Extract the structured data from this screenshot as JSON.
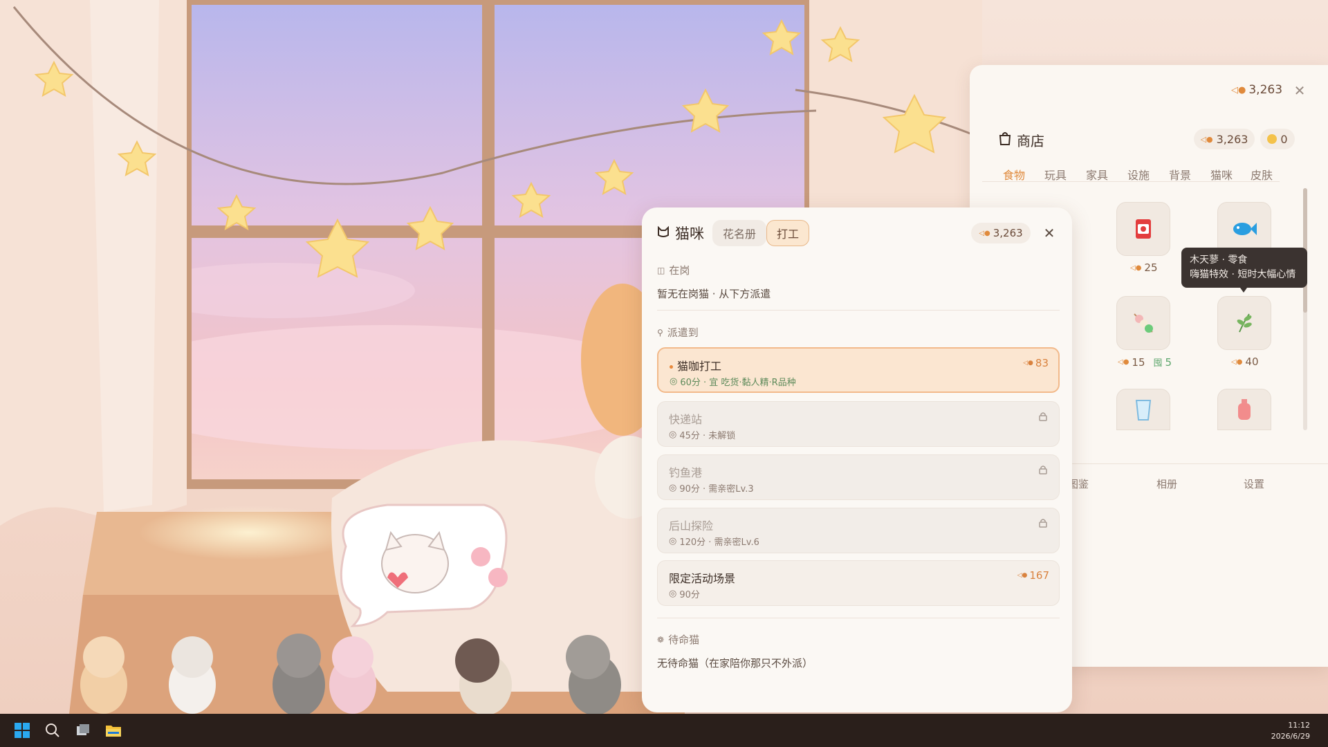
{
  "shop": {
    "top_coins": "3,263",
    "title": "商店",
    "coins_pill": "3,263",
    "gems_pill": "0",
    "tabs": [
      "食物",
      "玩具",
      "家具",
      "设施",
      "背景",
      "猫咪",
      "皮肤"
    ],
    "active_tab": "食物",
    "items": [
      {
        "icon": "canned-food-icon",
        "price": "25",
        "extra": ""
      },
      {
        "icon": "fish-icon",
        "price": "",
        "extra": ""
      },
      {
        "icon": "dango-icon",
        "price": "15",
        "extra": "5"
      },
      {
        "icon": "catnip-icon",
        "price": "40",
        "extra": ""
      },
      {
        "icon": "milk-icon",
        "price": "",
        "extra": ""
      },
      {
        "icon": "bottle-icon",
        "price": "",
        "extra": ""
      }
    ],
    "tooltip": {
      "line1": "木天蓼 · 零食",
      "line2": "嗨猫特效 · 短时大幅心情"
    },
    "bottom_nav": [
      "图鉴",
      "相册",
      "设置"
    ]
  },
  "cat_panel": {
    "title": "猫咪",
    "tab_roster": "花名册",
    "tab_work": "打工",
    "coins": "3,263",
    "on_duty_label": "在岗",
    "on_duty_text": "暂无在岗猫 · 从下方派遣",
    "dispatch_label": "派遣到",
    "jobs": [
      {
        "name": "猫咖打工",
        "meta": "60分 · 宜 吃货·黏人精·R品种",
        "reward": "83",
        "state": "selected"
      },
      {
        "name": "快递站",
        "meta": "45分 · 未解锁",
        "reward": "",
        "state": "locked"
      },
      {
        "name": "钓鱼港",
        "meta": "90分 · 需亲密Lv.3",
        "reward": "",
        "state": "locked"
      },
      {
        "name": "后山探险",
        "meta": "120分 · 需亲密Lv.6",
        "reward": "",
        "state": "locked"
      },
      {
        "name": "限定活动场景",
        "meta": "90分",
        "reward": "167",
        "state": "special"
      }
    ],
    "standby_label": "待命猫",
    "standby_text": "无待命猫（在家陪你那只不外派）"
  },
  "taskbar": {
    "time": "11:12",
    "date": "2026/6/29",
    "icons": [
      "windows-start-icon",
      "search-icon",
      "task-view-icon",
      "file-explorer-icon"
    ]
  },
  "colors": {
    "accent": "#e08a3c",
    "panel_bg": "#fbf8f4",
    "selected_job_bg": "#fbe6d1",
    "taskbar": "#2a1f1b"
  }
}
